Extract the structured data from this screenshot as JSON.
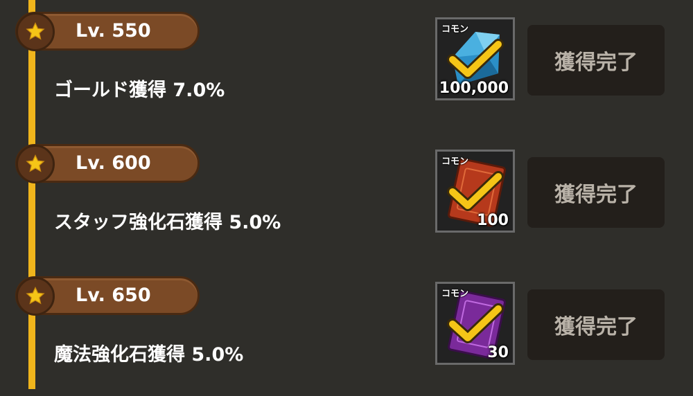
{
  "milestones": [
    {
      "level": "Lv. 550",
      "bonus": "ゴールド獲得 7.0%",
      "reward": {
        "rarity": "コモン",
        "quantity": "100,000",
        "item_icon": "blue-crystal-icon",
        "claimed": true
      },
      "status": "獲得完了"
    },
    {
      "level": "Lv. 600",
      "bonus": "スタッフ強化石獲得 5.0%",
      "reward": {
        "rarity": "コモン",
        "quantity": "100",
        "item_icon": "red-card-icon",
        "claimed": true
      },
      "status": "獲得完了"
    },
    {
      "level": "Lv. 650",
      "bonus": "魔法強化石獲得 5.0%",
      "reward": {
        "rarity": "コモン",
        "quantity": "30",
        "item_icon": "purple-card-icon",
        "claimed": true
      },
      "status": "獲得完了"
    }
  ],
  "colors": {
    "timeline": "#f0b51c",
    "pill": "#7b4a26",
    "check": "#f5c517",
    "button_bg": "#231f1b"
  }
}
